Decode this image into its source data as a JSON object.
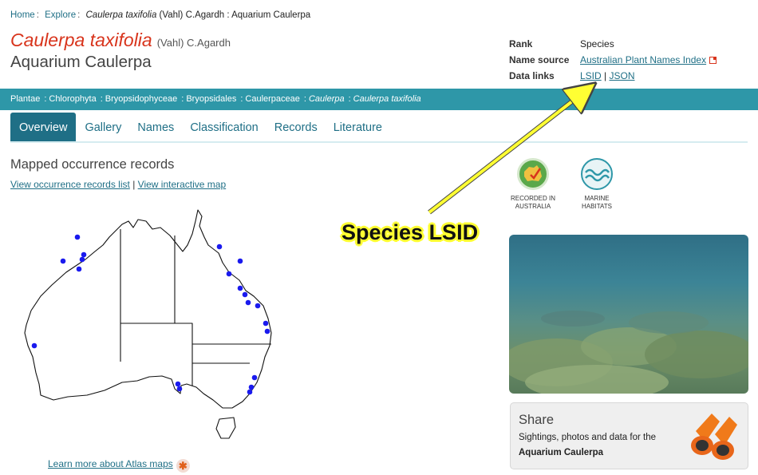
{
  "breadcrumb": {
    "home": "Home",
    "explore": "Explore",
    "current_sci": "Caulerpa taxifolia",
    "current_rest": " (Vahl) C.Agardh : Aquarium Caulerpa",
    "separator": ":"
  },
  "species": {
    "scientific_name": "Caulerpa taxifolia",
    "authority": "(Vahl) C.Agardh",
    "common_name": "Aquarium Caulerpa"
  },
  "meta": {
    "rank_label": "Rank",
    "rank_value": "Species",
    "name_source_label": "Name source",
    "name_source_value": "Australian Plant Names Index",
    "data_links_label": "Data links",
    "lsid": "LSID",
    "link_separator": "|",
    "json": "JSON"
  },
  "taxonomy": [
    {
      "name": "Plantae",
      "italic": false
    },
    {
      "name": "Chlorophyta",
      "italic": false
    },
    {
      "name": "Bryopsidophyceae",
      "italic": false
    },
    {
      "name": "Bryopsidales",
      "italic": false
    },
    {
      "name": "Caulerpaceae",
      "italic": false
    },
    {
      "name": "Caulerpa",
      "italic": true
    },
    {
      "name": "Caulerpa taxifolia",
      "italic": true
    }
  ],
  "tabs": [
    "Overview",
    "Gallery",
    "Names",
    "Classification",
    "Records",
    "Literature"
  ],
  "active_tab": "Overview",
  "occurrence": {
    "heading": "Mapped occurrence records",
    "list_link": "View occurrence records list",
    "separator": "|",
    "map_link": "View interactive map",
    "learn_link": "Learn more about Atlas maps"
  },
  "badges": [
    {
      "line1": "RECORDED IN",
      "line2": "AUSTRALIA",
      "icon": "australia-map-icon",
      "color": "#5aa84a"
    },
    {
      "line1": "MARINE",
      "line2": "HABITATS",
      "icon": "waves-icon",
      "color": "#2e97a8"
    }
  ],
  "annotation": {
    "text": "Species LSID",
    "color": "#ffff33"
  },
  "share": {
    "heading": "Share",
    "line1": "Sightings, photos and data for the",
    "line2": "Aquarium Caulerpa"
  },
  "colors": {
    "accent": "#1f6f86",
    "bar": "#2e97a8",
    "title": "#d8341c",
    "dot": "#1a1aee"
  }
}
